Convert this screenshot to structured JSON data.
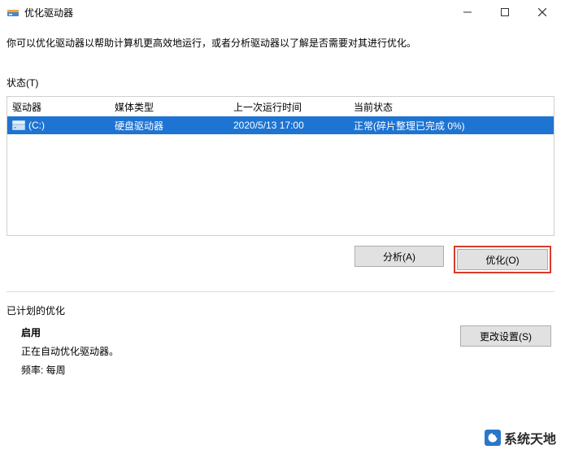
{
  "window": {
    "title": "优化驱动器"
  },
  "desc": "你可以优化驱动器以帮助计算机更高效地运行，或者分析驱动器以了解是否需要对其进行优化。",
  "status_label": "状态(T)",
  "columns": {
    "drive": "驱动器",
    "media": "媒体类型",
    "lastrun": "上一次运行时间",
    "state": "当前状态"
  },
  "row": {
    "drive": "(C:)",
    "media": "硬盘驱动器",
    "lastrun": "2020/5/13 17:00",
    "state": "正常(碎片整理已完成 0%)"
  },
  "buttons": {
    "analyze": "分析(A)",
    "optimize": "优化(O)",
    "change": "更改设置(S)"
  },
  "schedule": {
    "title": "已计划的优化",
    "on": "启用",
    "desc": "正在自动优化驱动器。",
    "freq": "频率: 每周"
  },
  "watermark": "系统天地"
}
